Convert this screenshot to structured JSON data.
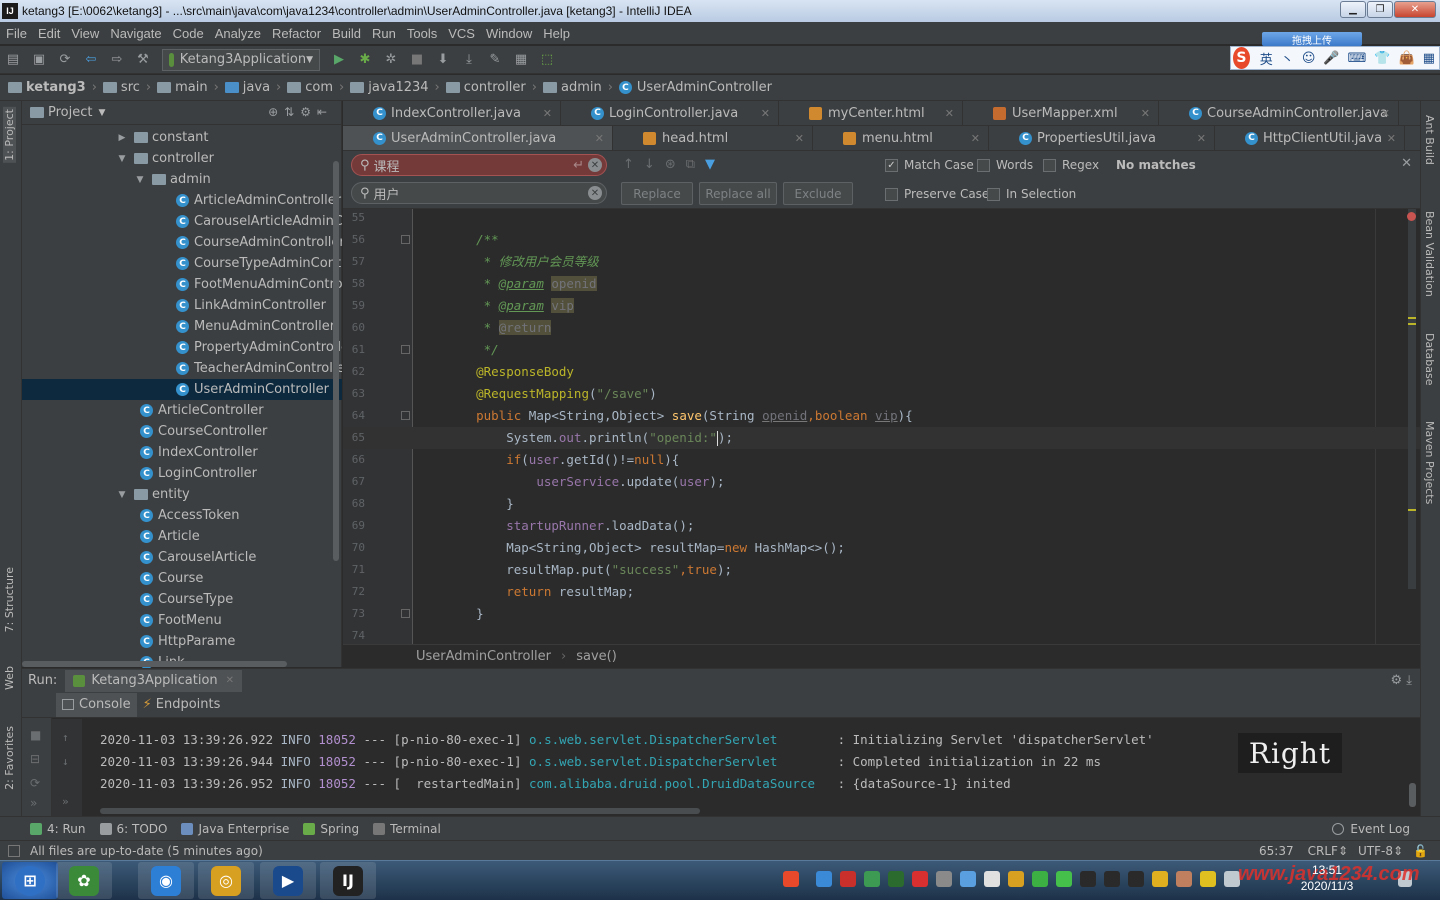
{
  "window": {
    "title": "ketang3 [E:\\0062\\ketang3] - ...\\src\\main\\java\\com\\java1234\\controller\\admin\\UserAdminController.java [ketang3] - IntelliJ IDEA",
    "app_icon_text": "IJ",
    "controls": [
      "minimize",
      "maximize",
      "close"
    ]
  },
  "menu": [
    "File",
    "Edit",
    "View",
    "Navigate",
    "Code",
    "Analyze",
    "Refactor",
    "Build",
    "Run",
    "Tools",
    "VCS",
    "Window",
    "Help"
  ],
  "toolbar": {
    "run_config": "Ketang3Application",
    "icons": [
      "open-folder-icon",
      "save-icon",
      "sync-icon",
      "back-icon",
      "forward-icon",
      "run-icon",
      "debug-icon",
      "coverage-icon",
      "stop-icon",
      "build-icon",
      "download-icon",
      "project-structure-icon",
      "sdk-icon"
    ]
  },
  "ime": {
    "top_label": "拖拽上传",
    "logo": "S",
    "items": [
      "英",
      "丶",
      "☺",
      "🎤",
      "⌨",
      "👕",
      "👜",
      "▦"
    ]
  },
  "breadcrumb": [
    "ketang3",
    "src",
    "main",
    "java",
    "com",
    "java1234",
    "controller",
    "admin",
    "UserAdminController"
  ],
  "project_panel": {
    "title": "Project",
    "tree": [
      {
        "label": "constant",
        "type": "folder",
        "level": 1,
        "expanded": false
      },
      {
        "label": "controller",
        "type": "folder",
        "level": 1,
        "expanded": true
      },
      {
        "label": "admin",
        "type": "folder",
        "level": 2,
        "expanded": true
      },
      {
        "label": "ArticleAdminController",
        "type": "class",
        "level": 3
      },
      {
        "label": "CarouselArticleAdminController",
        "type": "class",
        "level": 3
      },
      {
        "label": "CourseAdminController",
        "type": "class",
        "level": 3
      },
      {
        "label": "CourseTypeAdminController",
        "type": "class",
        "level": 3
      },
      {
        "label": "FootMenuAdminController",
        "type": "class",
        "level": 3
      },
      {
        "label": "LinkAdminController",
        "type": "class",
        "level": 3
      },
      {
        "label": "MenuAdminController",
        "type": "class",
        "level": 3
      },
      {
        "label": "PropertyAdminController",
        "type": "class",
        "level": 3
      },
      {
        "label": "TeacherAdminController",
        "type": "class",
        "level": 3
      },
      {
        "label": "UserAdminController",
        "type": "class",
        "level": 3,
        "selected": true
      },
      {
        "label": "ArticleController",
        "type": "class",
        "level": 2
      },
      {
        "label": "CourseController",
        "type": "class",
        "level": 2
      },
      {
        "label": "IndexController",
        "type": "class",
        "level": 2
      },
      {
        "label": "LoginController",
        "type": "class",
        "level": 2
      },
      {
        "label": "entity",
        "type": "folder",
        "level": 1,
        "expanded": true
      },
      {
        "label": "AccessToken",
        "type": "class",
        "level": 2
      },
      {
        "label": "Article",
        "type": "class",
        "level": 2
      },
      {
        "label": "CarouselArticle",
        "type": "class",
        "level": 2
      },
      {
        "label": "Course",
        "type": "class",
        "level": 2
      },
      {
        "label": "CourseType",
        "type": "class",
        "level": 2
      },
      {
        "label": "FootMenu",
        "type": "class",
        "level": 2
      },
      {
        "label": "HttpParame",
        "type": "class",
        "level": 2
      },
      {
        "label": "Link",
        "type": "class",
        "level": 2
      }
    ]
  },
  "left_strip": [
    "1: Project",
    "7: Structure",
    "Web",
    "2: Favorites"
  ],
  "right_strip": [
    "Ant Build",
    "Bean Validation",
    "Database",
    "Maven Projects"
  ],
  "editor_tabs_row1": [
    {
      "label": "IndexController.java",
      "kind": "class"
    },
    {
      "label": "LoginController.java",
      "kind": "class"
    },
    {
      "label": "myCenter.html",
      "kind": "html"
    },
    {
      "label": "UserMapper.xml",
      "kind": "xml"
    },
    {
      "label": "CourseAdminController.java",
      "kind": "class"
    }
  ],
  "editor_tabs_row2": [
    {
      "label": "UserAdminController.java",
      "kind": "class",
      "active": true
    },
    {
      "label": "head.html",
      "kind": "html"
    },
    {
      "label": "menu.html",
      "kind": "html"
    },
    {
      "label": "PropertiesUtil.java",
      "kind": "class"
    },
    {
      "label": "HttpClientUtil.java",
      "kind": "class"
    }
  ],
  "search": {
    "find_value": "课程",
    "replace_value": "用户",
    "status": "No matches",
    "buttons": [
      "Replace",
      "Replace all",
      "Exclude"
    ],
    "options": [
      {
        "label": "Match Case",
        "checked": true
      },
      {
        "label": "Words",
        "checked": false
      },
      {
        "label": "Regex",
        "checked": false
      },
      {
        "label": "Preserve Case",
        "checked": false
      },
      {
        "label": "In Selection",
        "checked": false
      }
    ]
  },
  "code": {
    "lines": [
      {
        "n": "55",
        "parts": []
      },
      {
        "n": "56",
        "parts": [
          [
            "cm",
            "    /**"
          ]
        ]
      },
      {
        "n": "57",
        "parts": [
          [
            "cm",
            "     * 修改用户会员等级"
          ]
        ]
      },
      {
        "n": "58",
        "parts": [
          [
            "cm",
            "     * "
          ],
          [
            "tag",
            "@param"
          ],
          [
            "pl",
            " "
          ],
          [
            "hl",
            "openid"
          ]
        ]
      },
      {
        "n": "59",
        "parts": [
          [
            "cm",
            "     * "
          ],
          [
            "tag",
            "@param"
          ],
          [
            "pl",
            " "
          ],
          [
            "hl",
            "vip"
          ]
        ]
      },
      {
        "n": "60",
        "parts": [
          [
            "cm",
            "     * "
          ],
          [
            "hl",
            "@return"
          ]
        ]
      },
      {
        "n": "61",
        "parts": [
          [
            "cm",
            "     */"
          ]
        ]
      },
      {
        "n": "62",
        "parts": [
          [
            "ann",
            "    @ResponseBody"
          ]
        ]
      },
      {
        "n": "63",
        "parts": [
          [
            "ann",
            "    @RequestMapping"
          ],
          [
            "pl",
            "("
          ],
          [
            "str",
            "\"/save\""
          ],
          [
            "pl",
            ")"
          ]
        ]
      },
      {
        "n": "64",
        "parts": [
          [
            "kw",
            "    public "
          ],
          [
            "pl",
            "Map<String,Object> "
          ],
          [
            "mt",
            "save"
          ],
          [
            "pl",
            "(String "
          ],
          [
            "dimu",
            "openid"
          ],
          [
            "kw",
            ","
          ],
          [
            "kw",
            "boolean "
          ],
          [
            "dimu",
            "vip"
          ],
          [
            "pl",
            "){"
          ]
        ]
      },
      {
        "n": "65",
        "parts": [
          [
            "pl",
            "        System."
          ],
          [
            "fld",
            "out"
          ],
          [
            "pl",
            ".println("
          ],
          [
            "str",
            "\"openid:\""
          ],
          [
            "pl",
            ");"
          ]
        ],
        "current": true
      },
      {
        "n": "66",
        "parts": [
          [
            "kw",
            "        if"
          ],
          [
            "pl",
            "("
          ],
          [
            "fld",
            "user"
          ],
          [
            "pl",
            ".getId()!="
          ],
          [
            "kw",
            "null"
          ],
          [
            "pl",
            "){"
          ]
        ]
      },
      {
        "n": "67",
        "parts": [
          [
            "pl",
            "            "
          ],
          [
            "fld",
            "userService"
          ],
          [
            "pl",
            ".update("
          ],
          [
            "fld",
            "user"
          ],
          [
            "pl",
            ");"
          ]
        ]
      },
      {
        "n": "68",
        "parts": [
          [
            "pl",
            "        }"
          ]
        ]
      },
      {
        "n": "69",
        "parts": [
          [
            "pl",
            "        "
          ],
          [
            "fld",
            "startupRunner"
          ],
          [
            "pl",
            ".loadData();"
          ]
        ]
      },
      {
        "n": "70",
        "parts": [
          [
            "pl",
            "        Map<String,Object> resultMap="
          ],
          [
            "kw",
            "new "
          ],
          [
            "pl",
            "HashMap<>();"
          ]
        ]
      },
      {
        "n": "71",
        "parts": [
          [
            "pl",
            "        resultMap.put("
          ],
          [
            "str",
            "\"success\""
          ],
          [
            "kw",
            ","
          ],
          [
            "kw",
            "true"
          ],
          [
            "pl",
            ");"
          ]
        ]
      },
      {
        "n": "72",
        "parts": [
          [
            "kw",
            "        return "
          ],
          [
            "pl",
            "resultMap;"
          ]
        ]
      },
      {
        "n": "73",
        "parts": [
          [
            "pl",
            "    }"
          ]
        ]
      },
      {
        "n": "74",
        "parts": []
      }
    ]
  },
  "editor_breadcrumb": [
    "UserAdminController",
    "save()"
  ],
  "run_panel": {
    "label": "Run:",
    "config": "Ketang3Application",
    "tabs": [
      "Console",
      "Endpoints"
    ],
    "logs": [
      {
        "time": "2020-11-03 13:39:26.922",
        "level": "INFO",
        "pid": "18052",
        "sep": "---",
        "thread": "[p-nio-80-exec-1]",
        "logger": "o.s.web.servlet.DispatcherServlet       ",
        "msg": ": Initializing Servlet 'dispatcherServlet'"
      },
      {
        "time": "2020-11-03 13:39:26.944",
        "level": "INFO",
        "pid": "18052",
        "sep": "---",
        "thread": "[p-nio-80-exec-1]",
        "logger": "o.s.web.servlet.DispatcherServlet       ",
        "msg": ": Completed initialization in 22 ms"
      },
      {
        "time": "2020-11-03 13:39:26.952",
        "level": "INFO",
        "pid": "18052",
        "sep": "---",
        "thread": "[  restartedMain]",
        "logger": "com.alibaba.druid.pool.DruidDataSource  ",
        "msg": ": {dataSource-1} inited"
      }
    ],
    "overlay_text": "Right"
  },
  "tool_tabs": [
    {
      "label": "4: Run",
      "icon": "run-icon",
      "color": "#59a869"
    },
    {
      "label": "6: TODO",
      "icon": "todo-icon",
      "color": "#9a9da0"
    },
    {
      "label": "Java Enterprise",
      "icon": "java-enterprise-icon",
      "color": "#6c8ebf"
    },
    {
      "label": "Spring",
      "icon": "spring-icon",
      "color": "#6aab49"
    },
    {
      "label": "Terminal",
      "icon": "terminal-icon",
      "color": "#777777"
    }
  ],
  "event_log": "Event Log",
  "status": {
    "message": "All files are up-to-date (5 minutes ago)",
    "position": "65:37",
    "line_sep": "CRLF",
    "encoding": "UTF-8"
  },
  "taskbar": {
    "apps": [
      {
        "name": "start-button",
        "color": "#2f6fc4",
        "text": "⊞"
      },
      {
        "name": "taskbar-app-photos",
        "color": "#3b8a3a",
        "text": "✿"
      },
      {
        "name": "taskbar-app-qq-browser",
        "color": "#2d7fd6",
        "text": "◉"
      },
      {
        "name": "taskbar-app-chrome",
        "color": "#d8a020",
        "text": "◎"
      },
      {
        "name": "taskbar-app-media",
        "color": "#1b4a8c",
        "text": "▶"
      },
      {
        "name": "taskbar-app-intellij",
        "color": "#222222",
        "text": "IJ"
      }
    ],
    "clock_time": "13:51",
    "clock_date": "2020/11/3",
    "watermark": "www.java1234.com"
  },
  "colors": {
    "editor_bg": "#2b2b2b",
    "panel_bg": "#3c3f41",
    "selection": "#0d293e",
    "class_icon": "#3591cc"
  }
}
